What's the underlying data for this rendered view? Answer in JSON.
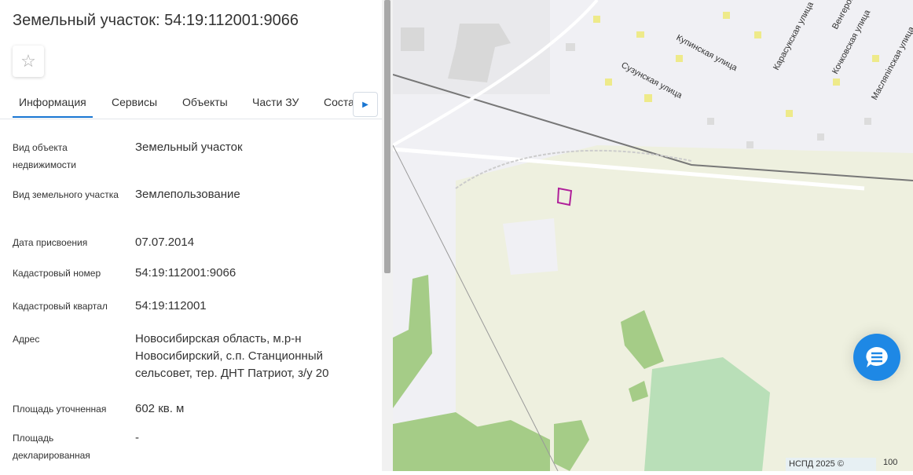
{
  "panel": {
    "title": "Земельный участок: 54:19:112001:9066",
    "tabs": [
      "Информация",
      "Сервисы",
      "Объекты",
      "Части ЗУ",
      "Соста"
    ],
    "rows": [
      {
        "label": "Вид объекта недвижимости",
        "value": "Земельный участок"
      },
      {
        "label": "Вид земельного участка",
        "value": "Землепользование"
      },
      {
        "label": "Дата присвоения",
        "value": "07.07.2014"
      },
      {
        "label": "Кадастровый номер",
        "value": "54:19:112001:9066"
      },
      {
        "label": "Кадастровый квартал",
        "value": "54:19:112001"
      },
      {
        "label": "Адрес",
        "value": "Новосибирская область, м.р-н Новосибирский, с.п. Станционный сельсовет, тер. ДНТ Патриот, з/у 20"
      },
      {
        "label": "Площадь уточненная",
        "value": "602 кв. м"
      },
      {
        "label": "Площадь декларированная",
        "value": "-"
      }
    ]
  },
  "map": {
    "streets": [
      "Купинская улица",
      "Сузунская улица",
      "Карасукская улица",
      "Кочковская улица",
      "Масляninская улица",
      "Венгеров"
    ],
    "copyright": "НСПД 2025 ©",
    "scale": "100"
  },
  "colors": {
    "accent": "#1976d2",
    "green": "#a5cc87",
    "parcel": "#b0209a"
  }
}
